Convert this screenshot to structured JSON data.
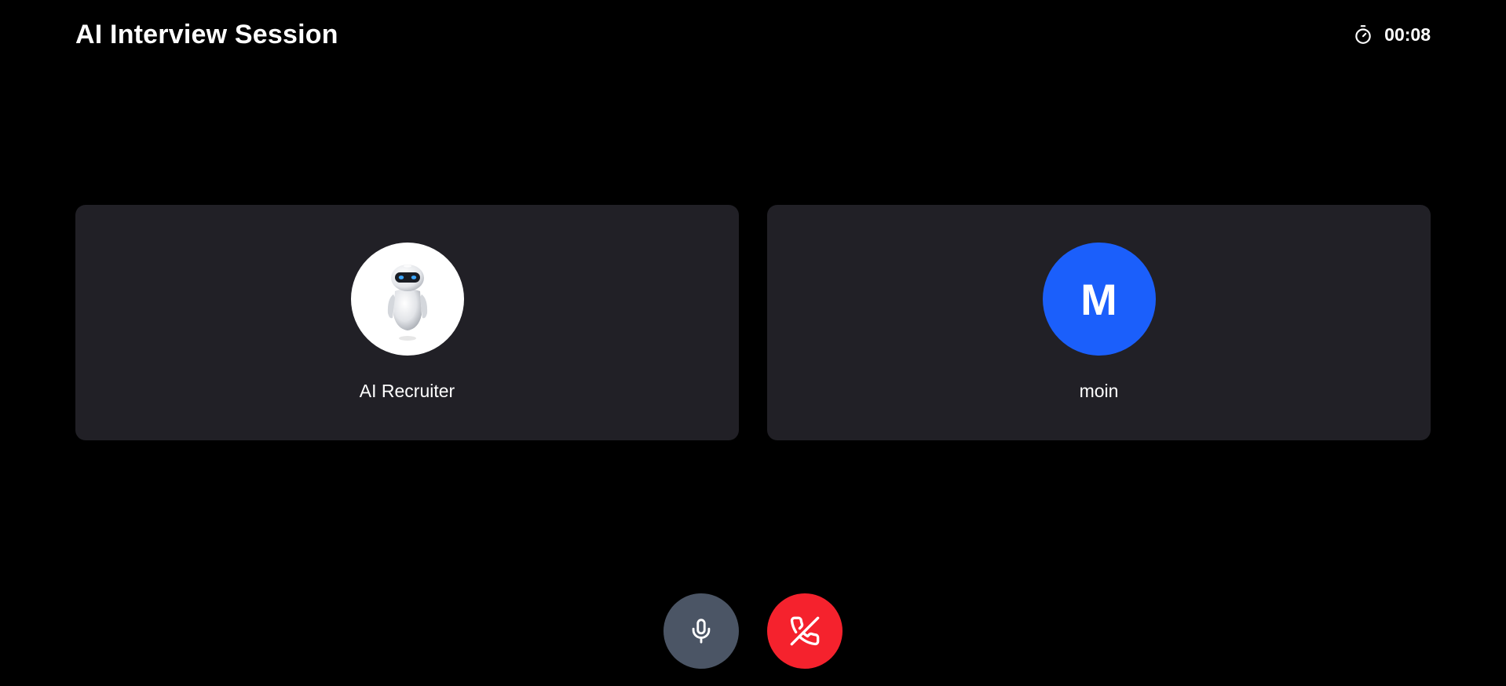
{
  "header": {
    "title": "AI Interview Session",
    "timer": "00:08",
    "timer_icon": "stopwatch-icon"
  },
  "participants": [
    {
      "name": "AI Recruiter",
      "avatar_type": "robot-image",
      "avatar_bg": "#ffffff"
    },
    {
      "name": "moin",
      "initial": "M",
      "avatar_type": "initial",
      "avatar_bg": "#1b5ffb"
    }
  ],
  "controls": {
    "mic": {
      "icon": "microphone-icon",
      "color": "#4b5565"
    },
    "end_call": {
      "icon": "phone-off-icon",
      "color": "#f5222d"
    }
  },
  "colors": {
    "background": "#000000",
    "tile": "#212026"
  }
}
